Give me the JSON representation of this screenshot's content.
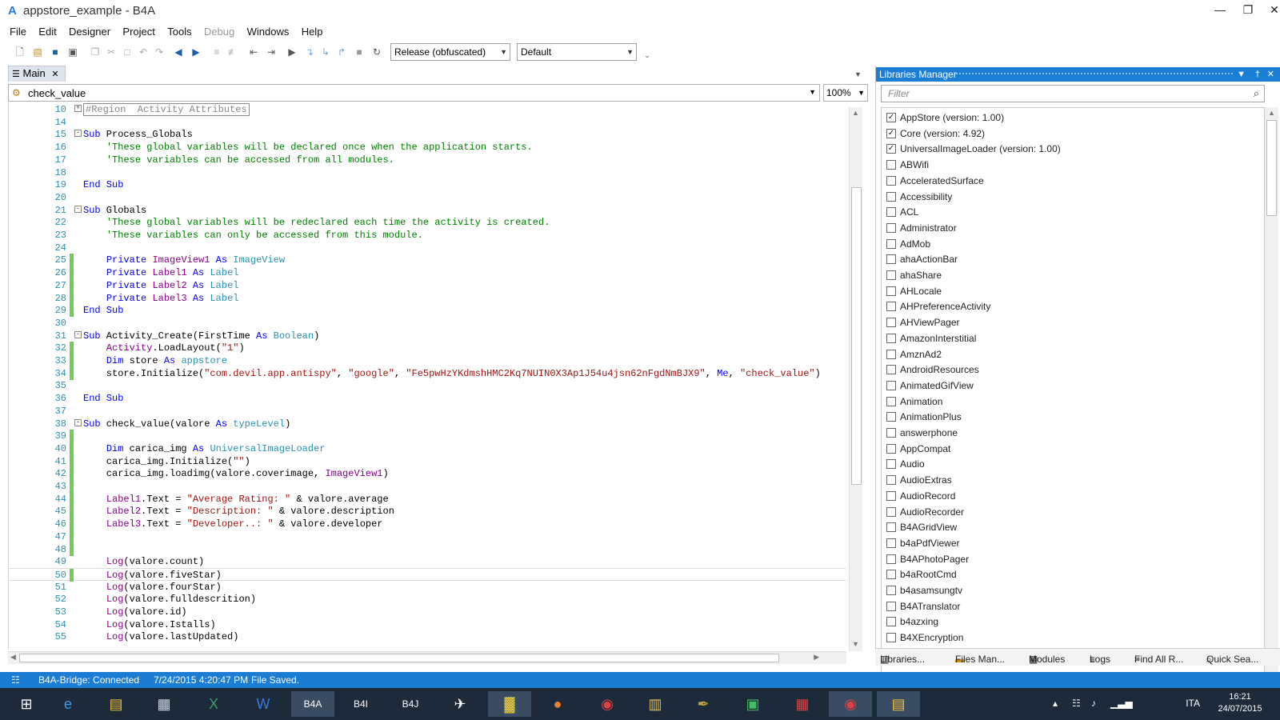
{
  "window": {
    "title": "appstore_example - B4A",
    "app_icon": "A",
    "minimize": "—",
    "restore": "❐",
    "close": "✕"
  },
  "menu": [
    "File",
    "Edit",
    "Designer",
    "Project",
    "Tools",
    "Debug",
    "Windows",
    "Help"
  ],
  "toolbar": {
    "build_config": "Release (obfuscated)",
    "device_profile": "Default"
  },
  "editor": {
    "tab_label": "Main",
    "sub_selector": "check_value",
    "zoom": "100%",
    "lines": [
      {
        "n": "10",
        "fold": "+",
        "html": "<span class=\"region\">#Region  Activity Attributes</span>"
      },
      {
        "n": "14",
        "html": ""
      },
      {
        "n": "15",
        "fold": "-",
        "html": "<span class=\"k\">Sub</span> Process_Globals"
      },
      {
        "n": "16",
        "html": "    <span class=\"c\">'These global variables will be declared once when the application starts.</span>"
      },
      {
        "n": "17",
        "html": "    <span class=\"c\">'These variables can be accessed from all modules.</span>"
      },
      {
        "n": "18",
        "html": ""
      },
      {
        "n": "19",
        "html": "<span class=\"k\">End Sub</span>"
      },
      {
        "n": "20",
        "html": ""
      },
      {
        "n": "21",
        "fold": "-",
        "html": "<span class=\"k\">Sub</span> Globals"
      },
      {
        "n": "22",
        "html": "    <span class=\"c\">'These global variables will be redeclared each time the activity is created.</span>"
      },
      {
        "n": "23",
        "html": "    <span class=\"c\">'These variables can only be accessed from this module.</span>"
      },
      {
        "n": "24",
        "html": ""
      },
      {
        "n": "25",
        "mod": true,
        "html": "    <span class=\"k\">Private</span> <span class=\"p\">ImageView1</span> <span class=\"k\">As</span> <span class=\"t\">ImageView</span>"
      },
      {
        "n": "26",
        "mod": true,
        "html": "    <span class=\"k\">Private</span> <span class=\"p\">Label1</span> <span class=\"k\">As</span> <span class=\"t\">Label</span>"
      },
      {
        "n": "27",
        "mod": true,
        "html": "    <span class=\"k\">Private</span> <span class=\"p\">Label2</span> <span class=\"k\">As</span> <span class=\"t\">Label</span>"
      },
      {
        "n": "28",
        "mod": true,
        "html": "    <span class=\"k\">Private</span> <span class=\"p\">Label3</span> <span class=\"k\">As</span> <span class=\"t\">Label</span>"
      },
      {
        "n": "29",
        "mod": true,
        "html": "<span class=\"k\">End Sub</span>"
      },
      {
        "n": "30",
        "html": ""
      },
      {
        "n": "31",
        "fold": "-",
        "html": "<span class=\"k\">Sub</span> Activity_Create(FirstTime <span class=\"k\">As</span> <span class=\"t\">Boolean</span>)"
      },
      {
        "n": "32",
        "mod": true,
        "html": "    <span class=\"p\">Activity</span>.LoadLayout(<span class=\"s\">\"1\"</span>)"
      },
      {
        "n": "33",
        "mod": true,
        "html": "    <span class=\"k\">Dim</span> store <span class=\"k\">As</span> <span class=\"t\">appstore</span>"
      },
      {
        "n": "34",
        "mod": true,
        "html": "    store.Initialize(<span class=\"s\">\"com.devil.app.antispy\"</span>, <span class=\"s\">\"google\"</span>, <span class=\"s\">\"Fe5pwHzYKdmshHMC2Kq7NUIN0X3Ap1J54u4jsn62nFgdNmBJX9\"</span>, <span class=\"k\">Me</span>, <span class=\"s\">\"check_value\"</span>)"
      },
      {
        "n": "35",
        "html": ""
      },
      {
        "n": "36",
        "html": "<span class=\"k\">End Sub</span>"
      },
      {
        "n": "37",
        "html": ""
      },
      {
        "n": "38",
        "fold": "-",
        "html": "<span class=\"k\">Sub</span> check_value(valore <span class=\"k\">As</span> <span class=\"t\">typeLevel</span>)"
      },
      {
        "n": "39",
        "mod": true,
        "html": ""
      },
      {
        "n": "40",
        "mod": true,
        "html": "    <span class=\"k\">Dim</span> carica_img <span class=\"k\">As</span> <span class=\"t\">UniversalImageLoader</span>"
      },
      {
        "n": "41",
        "mod": true,
        "html": "    carica_img.Initialize(<span class=\"s\">\"\"</span>)"
      },
      {
        "n": "42",
        "mod": true,
        "html": "    carica_img.loadimg(valore.coverimage, <span class=\"p\">ImageView1</span>)"
      },
      {
        "n": "43",
        "mod": true,
        "html": ""
      },
      {
        "n": "44",
        "mod": true,
        "html": "    <span class=\"p\">Label1</span>.Text = <span class=\"s\">\"Average Rating: \"</span> &amp; valore.average"
      },
      {
        "n": "45",
        "mod": true,
        "html": "    <span class=\"p\">Label2</span>.Text = <span class=\"s\">\"Description: \"</span> &amp; valore.description"
      },
      {
        "n": "46",
        "mod": true,
        "html": "    <span class=\"p\">Label3</span>.Text = <span class=\"s\">\"Developer..: \"</span> &amp; valore.developer"
      },
      {
        "n": "47",
        "mod": true,
        "html": ""
      },
      {
        "n": "48",
        "mod": true,
        "html": ""
      },
      {
        "n": "49",
        "html": "    <span class=\"p\">Log</span>(valore.count)"
      },
      {
        "n": "50",
        "mod": true,
        "current": true,
        "html": "    <span class=\"p\">Log</span>(valore.fiveStar)"
      },
      {
        "n": "51",
        "html": "    <span class=\"p\">Log</span>(valore.fourStar)"
      },
      {
        "n": "52",
        "html": "    <span class=\"p\">Log</span>(valore.fulldescrition)"
      },
      {
        "n": "53",
        "html": "    <span class=\"p\">Log</span>(valore.id)"
      },
      {
        "n": "54",
        "html": "    <span class=\"p\">Log</span>(valore.Istalls)"
      },
      {
        "n": "55",
        "html": "    <span class=\"p\">Log</span>(valore.lastUpdated)"
      }
    ]
  },
  "libraries_manager": {
    "title": "Libraries Manager",
    "filter_placeholder": "Filter",
    "items": [
      {
        "name": "AppStore (version: 1.00)",
        "checked": true
      },
      {
        "name": "Core (version: 4.92)",
        "checked": true
      },
      {
        "name": "UniversalImageLoader (version: 1.00)",
        "checked": true
      },
      {
        "name": "ABWifi",
        "checked": false
      },
      {
        "name": "AcceleratedSurface",
        "checked": false
      },
      {
        "name": "Accessibility",
        "checked": false
      },
      {
        "name": "ACL",
        "checked": false
      },
      {
        "name": "Administrator",
        "checked": false
      },
      {
        "name": "AdMob",
        "checked": false
      },
      {
        "name": "ahaActionBar",
        "checked": false
      },
      {
        "name": "ahaShare",
        "checked": false
      },
      {
        "name": "AHLocale",
        "checked": false
      },
      {
        "name": "AHPreferenceActivity",
        "checked": false
      },
      {
        "name": "AHViewPager",
        "checked": false
      },
      {
        "name": "AmazonInterstitial",
        "checked": false
      },
      {
        "name": "AmznAd2",
        "checked": false
      },
      {
        "name": "AndroidResources",
        "checked": false
      },
      {
        "name": "AnimatedGifView",
        "checked": false
      },
      {
        "name": "Animation",
        "checked": false
      },
      {
        "name": "AnimationPlus",
        "checked": false
      },
      {
        "name": "answerphone",
        "checked": false
      },
      {
        "name": "AppCompat",
        "checked": false
      },
      {
        "name": "Audio",
        "checked": false
      },
      {
        "name": "AudioExtras",
        "checked": false
      },
      {
        "name": "AudioRecord",
        "checked": false
      },
      {
        "name": "AudioRecorder",
        "checked": false
      },
      {
        "name": "B4AGridView",
        "checked": false
      },
      {
        "name": "b4aPdfViewer",
        "checked": false
      },
      {
        "name": "B4APhotoPager",
        "checked": false
      },
      {
        "name": "b4aRootCmd",
        "checked": false
      },
      {
        "name": "b4asamsungtv",
        "checked": false
      },
      {
        "name": "B4ATranslator",
        "checked": false
      },
      {
        "name": "b4azxing",
        "checked": false
      },
      {
        "name": "B4XEncryption",
        "checked": false
      }
    ],
    "bottom_tabs": [
      "Libraries...",
      "Files Man...",
      "Modules",
      "Logs",
      "Find All R...",
      "Quick Sea..."
    ]
  },
  "status": {
    "bridge": "B4A-Bridge: Connected",
    "timestamp": "7/24/2015 4:20:47 PM",
    "message": "File Saved."
  },
  "taskbar": {
    "language": "ITA",
    "time": "16:21",
    "date": "24/07/2015"
  },
  "colors": {
    "accent": "#1b7cd3",
    "taskbar": "#1c2a3a"
  }
}
